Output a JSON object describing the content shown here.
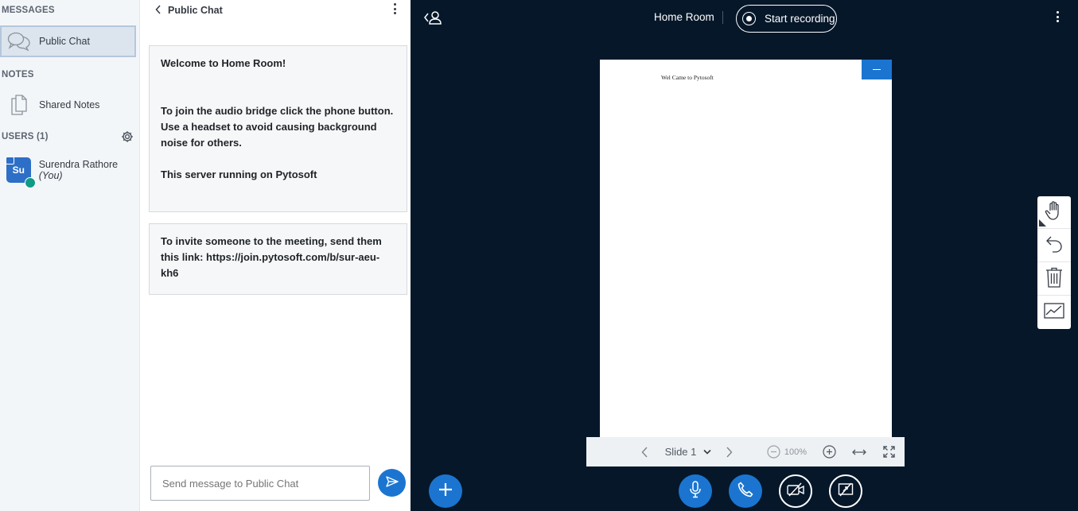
{
  "sidebar": {
    "messages_title": "MESSAGES",
    "public_chat_label": "Public Chat",
    "notes_title": "NOTES",
    "shared_notes_label": "Shared Notes",
    "users_title": "USERS (1)",
    "user": {
      "initials": "Su",
      "name": "Surendra Rathore",
      "you_label": "(You)"
    }
  },
  "chat": {
    "title": "Public Chat",
    "messages": [
      {
        "lines": [
          "Welcome to Home Room!",
          "",
          "",
          "To join the audio bridge click the phone button. Use a headset to avoid causing background noise for others.",
          "",
          "This server running on Pytosoft"
        ]
      },
      {
        "text": "To invite someone to the meeting, send them this link: https://join.pytosoft.com/b/sur-aeu-kh6"
      }
    ],
    "input_placeholder": "Send message to Public Chat"
  },
  "stage": {
    "room_title": "Home Room",
    "record_label": "Start recording",
    "slide_text": "Wel Came to Pytosoft",
    "toolbar": {
      "slide_label": "Slide 1",
      "zoom": "100%"
    }
  },
  "colors": {
    "accent": "#1b75d0",
    "stage_bg": "#06172a",
    "sidebar_bg": "#f3f6f9",
    "status_green": "#0f9b85"
  },
  "icons": [
    "chat-bubbles-icon",
    "notes-icon",
    "gear-icon",
    "send-icon",
    "users-toggle-icon",
    "record-icon",
    "hand-icon",
    "undo-icon",
    "trash-icon",
    "chart-icon",
    "plus-icon",
    "microphone-icon",
    "phone-icon",
    "camera-off-icon",
    "screenshare-off-icon"
  ]
}
